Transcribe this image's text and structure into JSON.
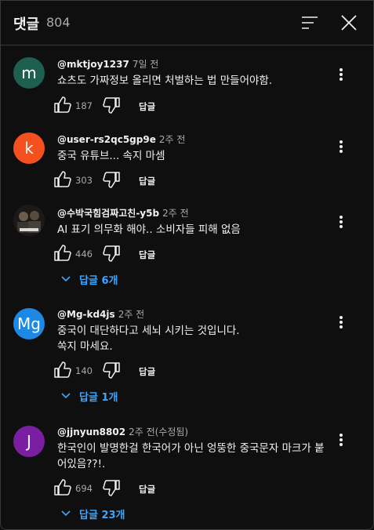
{
  "header": {
    "title": "댓글",
    "count": "804"
  },
  "colors": {
    "background": "#0f0f0f",
    "link": "#3ea6ff",
    "muted": "#aaaaaa"
  },
  "comments": [
    {
      "author": "@mktjoy1237",
      "time": "7일 전",
      "avatar_letter": "m",
      "avatar_color": "#1e5f4f",
      "text": "쇼츠도  가짜정보  올리면  처벌하는 법 만들어야함.",
      "likes": "187",
      "reply_label": "답글",
      "replies_label": ""
    },
    {
      "author": "@user-rs2qc5gp9e",
      "time": "2주 전",
      "avatar_letter": "k",
      "avatar_color": "#f4511e",
      "text": "중국 유튜브... 속지 마셈",
      "likes": "303",
      "reply_label": "답글",
      "replies_label": ""
    },
    {
      "author": "@수박국힘검짜고친-y5b",
      "time": "2주 전",
      "avatar_letter": "",
      "avatar_color": "#2a2622",
      "text": "AI 표기 의무화 해야.. 소비자들 피해 없음",
      "likes": "446",
      "reply_label": "답글",
      "replies_label": "답글 6개"
    },
    {
      "author": "@Mg-kd4js",
      "time": "2주 전",
      "avatar_letter": "Mg",
      "avatar_color": "#1e88e5",
      "text": "중국이 대단하다고 세뇌 시키는 것입니다.\n쏙지 마세요.",
      "likes": "140",
      "reply_label": "답글",
      "replies_label": "답글 1개"
    },
    {
      "author": "@jjnyun8802",
      "time": "2주 전(수정됨)",
      "avatar_letter": "J",
      "avatar_color": "#7b1fa2",
      "text": "한국인이 발명한걸 한국어가 아닌 엉뚱한 중국문자 마크가 붙어있음??!.",
      "likes": "694",
      "reply_label": "답글",
      "replies_label": "답글 23개"
    }
  ]
}
